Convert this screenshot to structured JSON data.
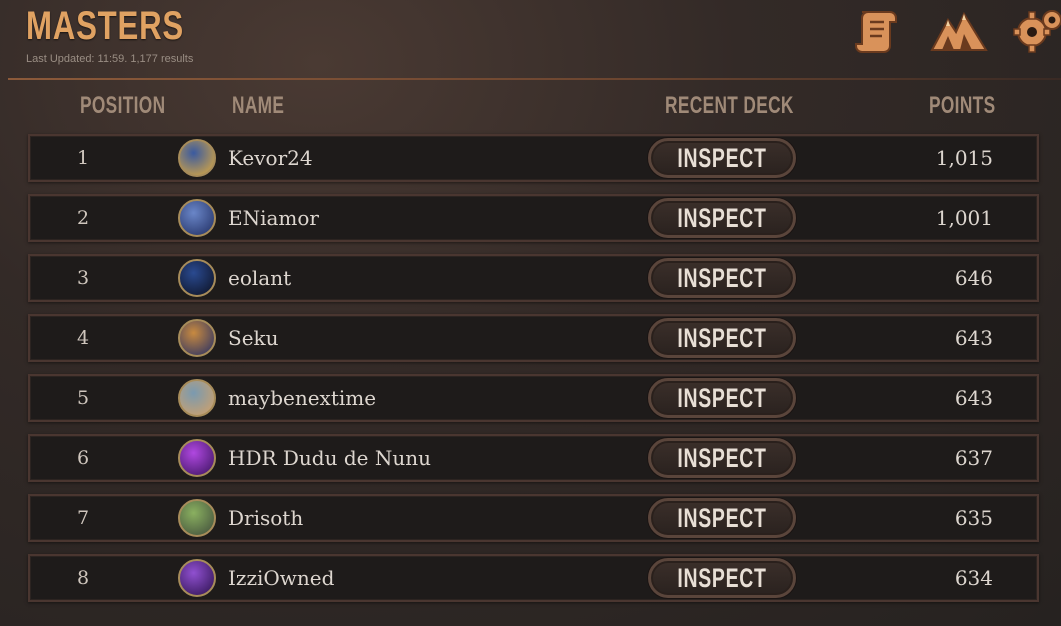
{
  "header": {
    "title": "MASTERS",
    "subtitle": "Last Updated: 11:59. 1,177 results"
  },
  "toolbar": {
    "icons": [
      "scroll-icon",
      "mountains-icon",
      "gear-icon"
    ]
  },
  "columns": {
    "position": "POSITION",
    "name": "NAME",
    "recent_deck": "RECENT DECK",
    "points": "POINTS"
  },
  "rows": [
    {
      "position": "1",
      "name": "Kevor24",
      "button": "INSPECT",
      "points": "1,015"
    },
    {
      "position": "2",
      "name": "ENiamor",
      "button": "INSPECT",
      "points": "1,001"
    },
    {
      "position": "3",
      "name": "eolant",
      "button": "INSPECT",
      "points": "646"
    },
    {
      "position": "4",
      "name": "Seku",
      "button": "INSPECT",
      "points": "643"
    },
    {
      "position": "5",
      "name": "maybenextime",
      "button": "INSPECT",
      "points": "643"
    },
    {
      "position": "6",
      "name": "HDR Dudu de Nunu",
      "button": "INSPECT",
      "points": "637"
    },
    {
      "position": "7",
      "name": "Drisoth",
      "button": "INSPECT",
      "points": "635"
    },
    {
      "position": "8",
      "name": "IzziOwned",
      "button": "INSPECT",
      "points": "634"
    }
  ],
  "colors": {
    "title": "#e0a262",
    "avatar_gradients": [
      [
        "#3a5aa0",
        "#c9a04a"
      ],
      [
        "#6a86c8",
        "#2a3a70"
      ],
      [
        "#2a4a90",
        "#101830"
      ],
      [
        "#c88a40",
        "#3a3a60"
      ],
      [
        "#7a9ab0",
        "#c8a070"
      ],
      [
        "#b048e0",
        "#4a1a70"
      ],
      [
        "#8ab060",
        "#4a5a40"
      ],
      [
        "#9050d0",
        "#3a1a60"
      ]
    ]
  }
}
